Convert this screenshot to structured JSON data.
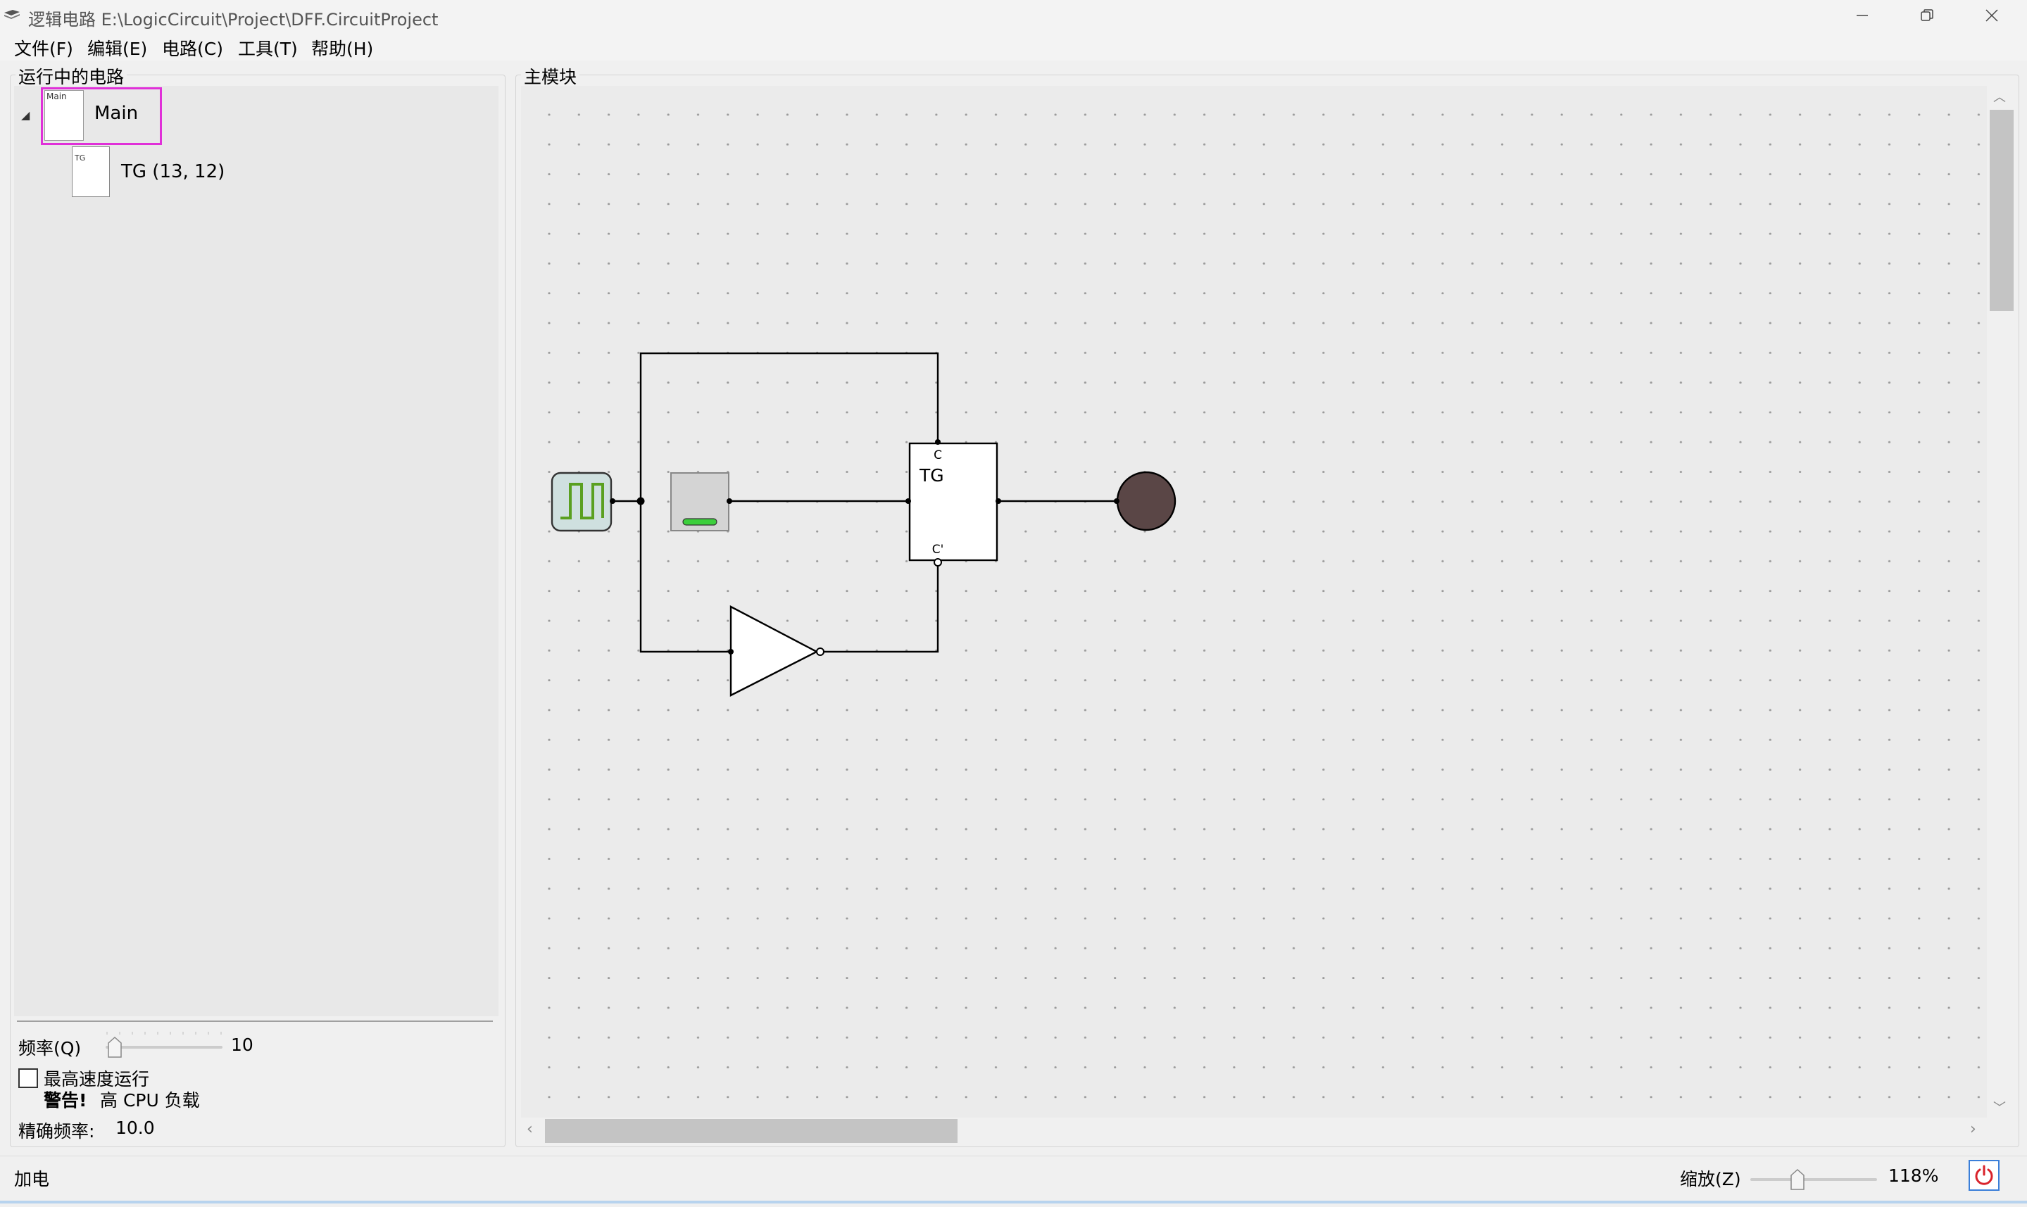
{
  "window": {
    "app_name": "逻辑电路",
    "path": "E:\\LogicCircuit\\Project\\DFF.CircuitProject"
  },
  "menu": [
    "文件(F)",
    "编辑(E)",
    "电路(C)",
    "工具(T)",
    "帮助(H)"
  ],
  "left_panel": {
    "title": "运行中的电路",
    "tree": {
      "root": {
        "label": "Main",
        "thumb_label": "Main"
      },
      "children": [
        {
          "label": "TG  (13, 12)",
          "thumb_label": "TG"
        }
      ]
    },
    "frequency": {
      "label": "频率(Q)",
      "value": "10"
    },
    "max_speed": {
      "label": "最高速度运行",
      "checked": false
    },
    "warning": {
      "label": "警告!",
      "text": "高 CPU 负载"
    },
    "actual_frequency": {
      "label": "精确频率:",
      "value": "10.0"
    }
  },
  "main_panel": {
    "title": "主模块",
    "circuit": {
      "tg_label": "TG",
      "tg_pin_c": "C",
      "tg_pin_c_bar": "C'",
      "clock_color": "#5aa020",
      "led_color": "#5a4646",
      "button_led_color": "#3ccf3c"
    }
  },
  "status": {
    "text": "加电",
    "zoom_label": "缩放(Z)",
    "zoom_value": "118%",
    "power_icon_color": "#d9232b"
  }
}
